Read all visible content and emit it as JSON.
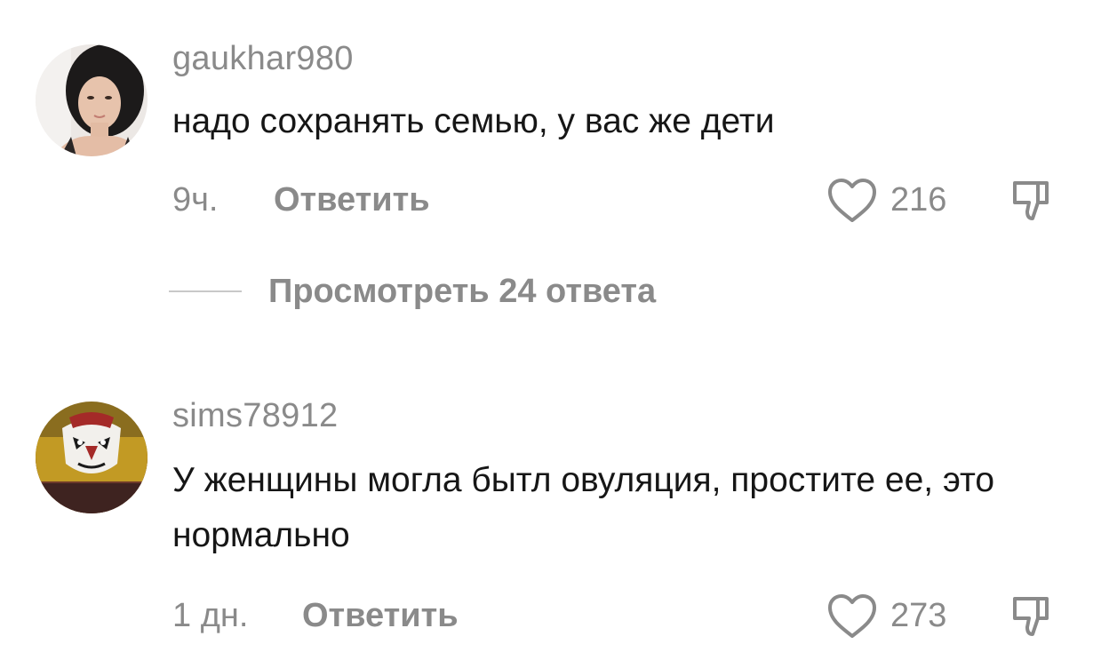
{
  "comments": [
    {
      "username": "gaukhar980",
      "text": "надо сохранять семью, у вас же дети",
      "time": "9ч.",
      "reply_label": "Ответить",
      "likes": "216",
      "view_replies_label": "Просмотреть 24 ответа"
    },
    {
      "username": "sims78912",
      "text": "У женщины могла бытл овуляция, простите ее, это нормально",
      "time": "1 дн.",
      "reply_label": "Ответить",
      "likes": "273"
    }
  ],
  "colors": {
    "secondary_text": "#8a8a8a",
    "primary_text": "#161616",
    "divider": "#c8c8c8"
  },
  "icons": {
    "like": "heart-outline-icon",
    "dislike": "thumbs-down-icon"
  }
}
